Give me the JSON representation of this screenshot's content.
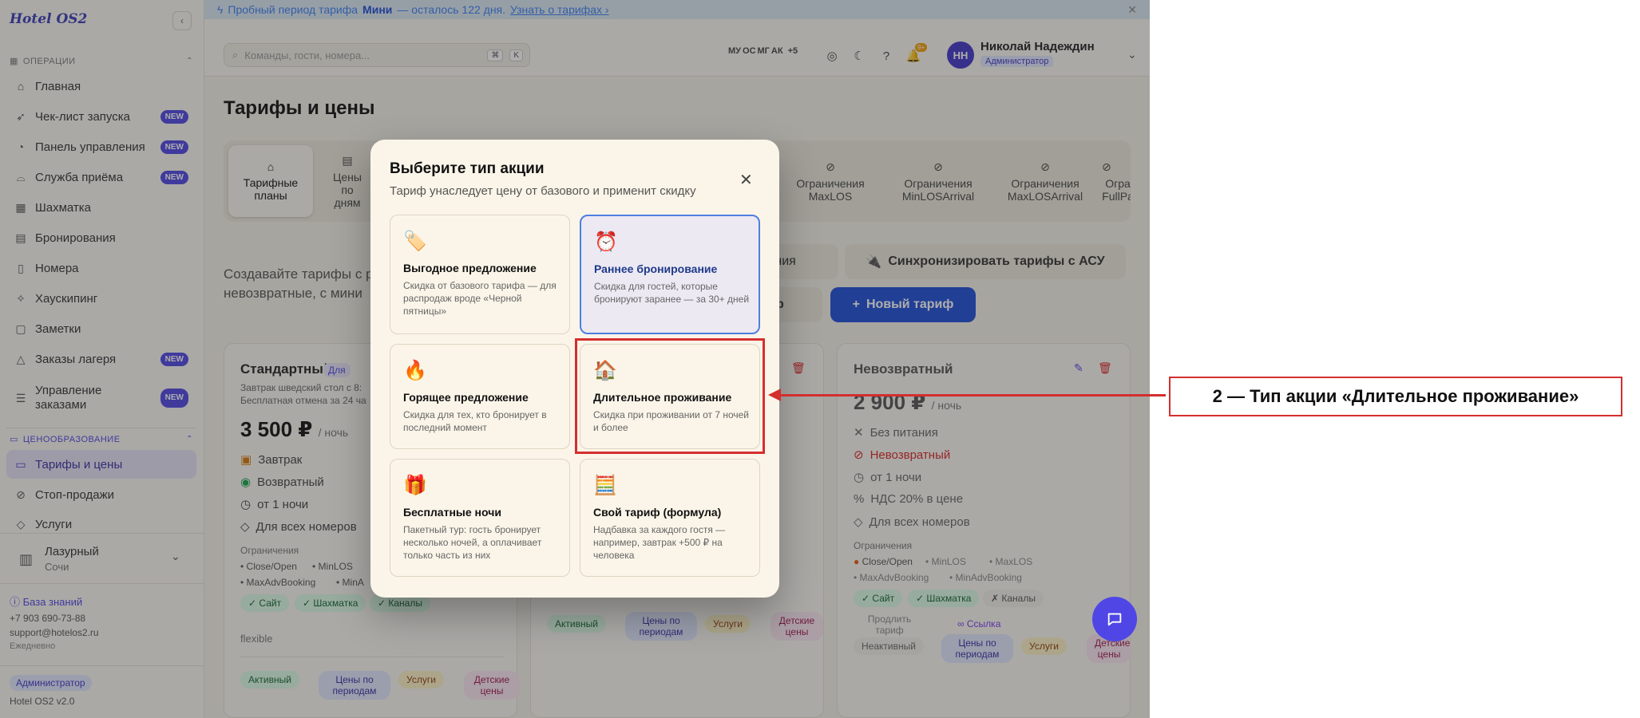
{
  "app": {
    "logo": "Hotel OS2"
  },
  "banner": {
    "text": "Пробный период тарифа",
    "plan": "Мини",
    "rest": "— осталось 122 дня.",
    "link": "Узнать о тарифах ›"
  },
  "sidebar": {
    "section_ops": "ОПЕРАЦИИ",
    "items": [
      {
        "label": "Главная",
        "icon": "home-icon",
        "glyph": "⌂",
        "new": ""
      },
      {
        "label": "Чек-лист запуска",
        "icon": "rocket-icon",
        "glyph": "🚀",
        "new": "NEW"
      },
      {
        "label": "Панель управления",
        "icon": "gauge-icon",
        "glyph": "◔",
        "new": "NEW"
      },
      {
        "label": "Служба приёма",
        "icon": "bell-icon",
        "glyph": "🛎",
        "new": "NEW"
      },
      {
        "label": "Шахматка",
        "icon": "grid-icon",
        "glyph": "▦",
        "new": ""
      },
      {
        "label": "Бронирования",
        "icon": "calendar-icon",
        "glyph": "▤",
        "new": ""
      },
      {
        "label": "Номера",
        "icon": "door-icon",
        "glyph": "▯",
        "new": ""
      },
      {
        "label": "Хаускипинг",
        "icon": "sparkle-icon",
        "glyph": "✧",
        "new": ""
      },
      {
        "label": "Заметки",
        "icon": "note-icon",
        "glyph": "▢",
        "new": ""
      },
      {
        "label": "Заказы лагеря",
        "icon": "tent-icon",
        "glyph": "⛺",
        "new": "NEW"
      },
      {
        "label": "Управление заказами",
        "icon": "orders-icon",
        "glyph": "☰",
        "new": "NEW"
      }
    ],
    "section_pricing": "ЦЕНООБРАЗОВАНИЕ",
    "pricing_items": [
      {
        "label": "Тарифы и цены",
        "glyph": "▭"
      },
      {
        "label": "Стоп-продажи",
        "glyph": "⊘"
      },
      {
        "label": "Услуги",
        "glyph": "◇"
      }
    ],
    "hotel_name": "Лазурный",
    "hotel_city": "Сочи",
    "kb": "База знаний",
    "phone": "+7 903 690-73-88",
    "email": "support@hotelos2.ru",
    "daily": "Ежедневно",
    "role": "Администратор",
    "version": "Hotel OS2 v2.0"
  },
  "topbar": {
    "search_placeholder": "Команды, гости, номера...",
    "kbd1": "⌘",
    "kbd2": "K",
    "avatars": [
      "МУ",
      "ОС",
      "МГ",
      "АК",
      "+5"
    ],
    "notif_count": "9+",
    "user_initials": "НН",
    "user_name": "Николай Надеждин",
    "user_role": "Администратор"
  },
  "page": {
    "title": "Тарифы и цены",
    "tabs": [
      "Тарифные планы",
      "Цены по дням",
      "Ограничения MaxLOS",
      "Ограничения MinLOSArrival",
      "Ограничения MaxLOSArrival",
      "Огра FullPa"
    ],
    "intro_line1": "Создавайте тарифы с р",
    "intro_line2": "невозвратные, с мини",
    "btn_restrictions": "чения",
    "btn_sync": "Синхронизировать тарифы с АСУ",
    "btn_tariff": "риф",
    "btn_new": "Новый тариф"
  },
  "cards": {
    "standard": {
      "title": "Стандартный",
      "badge": "Для",
      "sub1": "Завтрак шведский стол с 8:",
      "sub2": "Бесплатная отмена за 24 ча",
      "price": "3 500 ₽",
      "per": "/ ночь",
      "features": [
        "Завтрак",
        "Возвратный",
        "от 1 ночи",
        "Для всех номеров"
      ],
      "restr_label": "Ограничения",
      "restr": [
        "Close/Open",
        "MinLOS",
        "MaxAdvBooking",
        "MinA"
      ],
      "channels": [
        "✓ Сайт",
        "✓ Шахматка",
        "✓ Каналы"
      ],
      "code": "flexible",
      "chips": [
        "Активный",
        "Цены по периодам",
        "Услуги",
        "Детские цены"
      ]
    },
    "middle": {
      "chips": [
        "Активный",
        "Цены по периодам",
        "Услуги",
        "Детские цены"
      ]
    },
    "nonref": {
      "title": "Невозвратный",
      "price": "2 900 ₽",
      "per": "/ ночь",
      "features": [
        "Без питания",
        "Невозвратный",
        "от 1 ночи",
        "НДС 20% в цене",
        "Для всех номеров"
      ],
      "restr_label": "Ограничения",
      "restr": [
        "Close/Open",
        "MinLOS",
        "MaxLOS",
        "MaxAdvBooking",
        "MinAdvBooking"
      ],
      "channels": [
        "✓ Сайт",
        "✓ Шахматка",
        "✗ Каналы"
      ],
      "extend": "Продлить тариф",
      "link": "Ссылка",
      "chips": [
        "Неактивный",
        "Цены по периодам",
        "Услуги",
        "Детские цены"
      ]
    }
  },
  "modal": {
    "title": "Выберите тип акции",
    "subtitle": "Тариф унаследует цену от базового и применит скидку",
    "options": [
      {
        "emoji": "🏷️",
        "title": "Выгодное предложение",
        "desc": "Скидка от базового тарифа — для распродаж вроде «Черной пятницы»"
      },
      {
        "emoji": "⏰",
        "title": "Раннее бронирование",
        "desc": "Скидка для гостей, которые бронируют заранее — за 30+ дней"
      },
      {
        "emoji": "🔥",
        "title": "Горящее предложение",
        "desc": "Скидка для тех, кто бронирует в последний момент"
      },
      {
        "emoji": "🏠",
        "title": "Длительное проживание",
        "desc": "Скидка при проживании от 7 ночей и более"
      },
      {
        "emoji": "🎁",
        "title": "Бесплатные ночи",
        "desc": "Пакетный тур: гость бронирует несколько ночей, а оплачивает только часть из них"
      },
      {
        "emoji": "🧮",
        "title": "Свой тариф (формула)",
        "desc": "Надбавка за каждого гостя — например, завтрак +500 ₽ на человека"
      }
    ]
  },
  "annotation": {
    "text": "2 — Тип акции «Длительное проживание»"
  },
  "colors": {
    "accent": "#4f46e5",
    "highlight": "#d32f2f",
    "selected_border": "#4d7fe0"
  }
}
